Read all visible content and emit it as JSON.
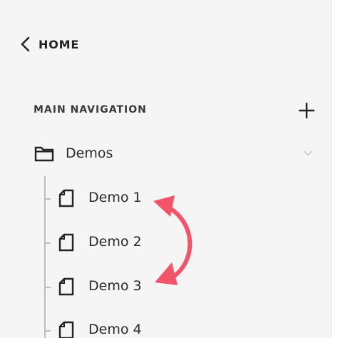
{
  "nav": {
    "back_label": "HOME"
  },
  "section": {
    "title": "MAIN NAVIGATION"
  },
  "folder": {
    "label": "Demos",
    "icon": "folder-icon"
  },
  "pages": [
    {
      "label": "Demo 1",
      "icon": "page-icon"
    },
    {
      "label": "Demo 2",
      "icon": "page-icon"
    },
    {
      "label": "Demo 3",
      "icon": "page-icon"
    },
    {
      "label": "Demo 4",
      "icon": "page-icon"
    }
  ],
  "colors": {
    "panel_background": "#f5f5f5",
    "text": "#222222",
    "tree_line": "#bdbdbd",
    "reorder_arrow": "#f2546a"
  }
}
